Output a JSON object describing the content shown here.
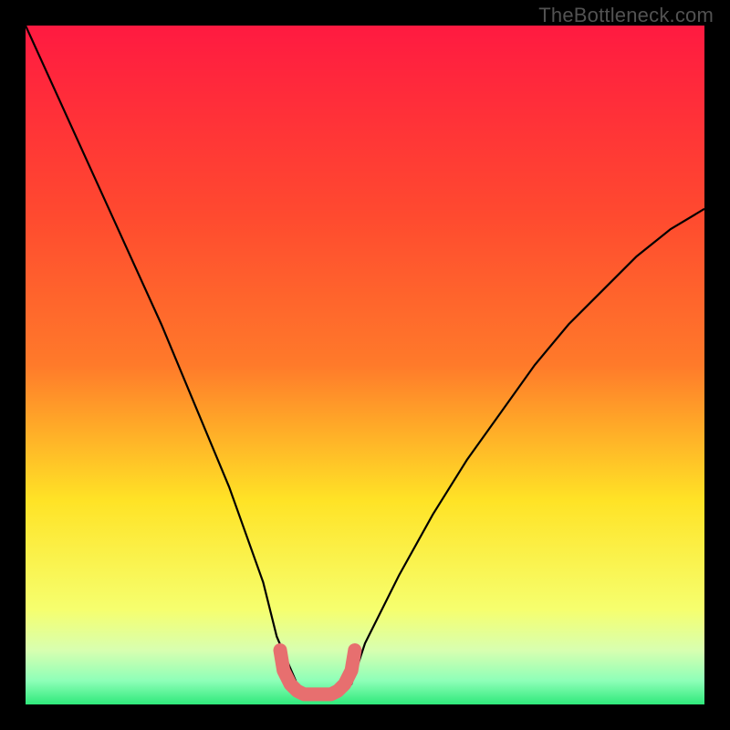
{
  "watermark": "TheBottleneck.com",
  "chart_data": {
    "type": "line",
    "title": "",
    "xlabel": "",
    "ylabel": "",
    "xlim": [
      0,
      100
    ],
    "ylim": [
      0,
      100
    ],
    "series": [
      {
        "name": "bottleneck-curve",
        "x": [
          0,
          5,
          10,
          15,
          20,
          25,
          30,
          35,
          37,
          40,
          42,
          44,
          46,
          48,
          50,
          55,
          60,
          65,
          70,
          75,
          80,
          85,
          90,
          95,
          100
        ],
        "y": [
          100,
          89,
          78,
          67,
          56,
          44,
          32,
          18,
          10,
          3,
          1.5,
          1.5,
          1.5,
          3,
          9,
          19,
          28,
          36,
          43,
          50,
          56,
          61,
          66,
          70,
          73
        ],
        "color": "#000000"
      }
    ],
    "highlight": {
      "name": "optimal-zone",
      "x": [
        37.5,
        38,
        39,
        40,
        41,
        42,
        43,
        44,
        45,
        46,
        47,
        48,
        48.5
      ],
      "y": [
        8,
        5,
        3,
        2,
        1.5,
        1.5,
        1.5,
        1.5,
        1.5,
        2,
        3,
        5,
        8
      ],
      "color": "#e76f6f"
    },
    "background_gradient": {
      "top": "#ff1a41",
      "upper_mid": "#ff7a2a",
      "mid": "#ffe326",
      "lower_mid": "#f6ff6e",
      "bottom": "#2fe97b"
    }
  }
}
